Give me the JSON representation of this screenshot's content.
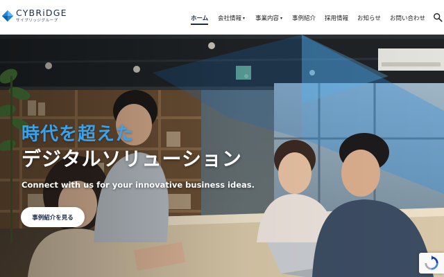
{
  "brand": {
    "name": "CYBRiDGE",
    "subtitle": "サイブリッジグループ",
    "accent_color": "#1e88d8",
    "navy_color": "#1b2a4a"
  },
  "nav": {
    "items": [
      {
        "label": "ホーム",
        "active": true,
        "dropdown": false
      },
      {
        "label": "会社情報",
        "active": false,
        "dropdown": true
      },
      {
        "label": "事業内容",
        "active": false,
        "dropdown": true
      },
      {
        "label": "事例紹介",
        "active": false,
        "dropdown": false
      },
      {
        "label": "採用情報",
        "active": false,
        "dropdown": false
      },
      {
        "label": "お知らせ",
        "active": false,
        "dropdown": false
      },
      {
        "label": "お問い合わせ",
        "active": false,
        "dropdown": false
      }
    ],
    "search_icon": "search-icon"
  },
  "hero": {
    "headline_line1": "時代を超えた",
    "headline_line2": "デジタルソリューション",
    "tagline": "Connect with us for your innovative business ideas.",
    "cta_label": "事例紹介を見る",
    "headline_accent_color": "#3aa2ea"
  },
  "widgets": {
    "recaptcha_icon": "recaptcha-icon"
  }
}
